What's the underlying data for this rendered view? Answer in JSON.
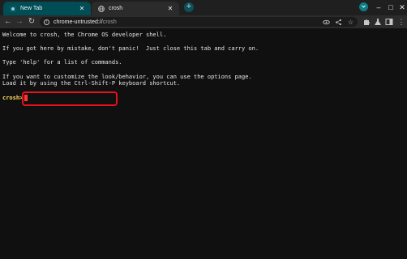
{
  "tabs": [
    {
      "label": "New Tab",
      "icon": "chrome-newtab-icon",
      "active": false
    },
    {
      "label": "crosh",
      "icon": "globe-icon",
      "active": true
    }
  ],
  "tab_close_glyph": "✕",
  "new_tab_glyph": "+",
  "window_controls": {
    "minimize": "–",
    "maximize": "□",
    "close": "✕"
  },
  "omnibox": {
    "url_host": "chrome-untrusted://",
    "url_path": "crosh"
  },
  "terminal": {
    "lines": [
      "Welcome to crosh, the Chrome OS developer shell.",
      "",
      "If you got here by mistake, don't panic!  Just close this tab and carry on.",
      "",
      "Type 'help' for a list of commands.",
      "",
      "If you want to customize the look/behavior, you can use the options page.",
      "Load it by using the Ctrl-Shift-P keyboard shortcut.",
      ""
    ],
    "prompt": "crosh>"
  },
  "colors": {
    "prompt": "#ffdf5e",
    "cursor": "#ff3737",
    "highlight": "#e8101a",
    "active_tab": "#004d56"
  }
}
